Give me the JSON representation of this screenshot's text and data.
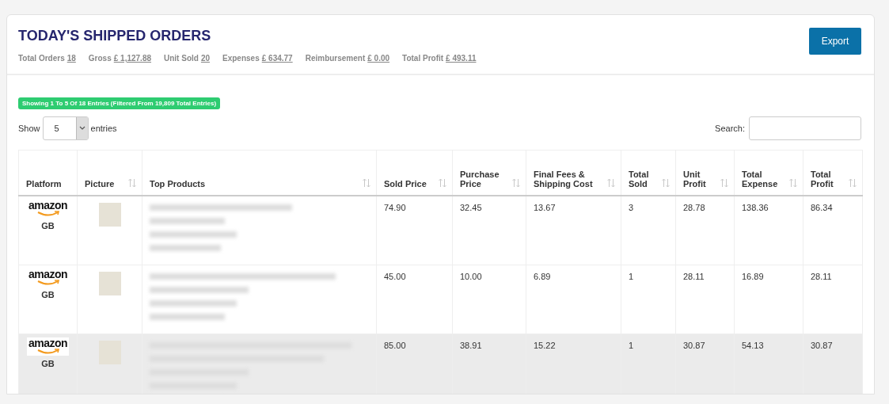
{
  "header": {
    "title": "TODAY'S SHIPPED ORDERS",
    "stats": [
      {
        "label": "Total Orders",
        "value": "18"
      },
      {
        "label": "Gross",
        "value": "£ 1,127.88"
      },
      {
        "label": "Unit Sold",
        "value": "20"
      },
      {
        "label": "Expenses",
        "value": "£ 634.77"
      },
      {
        "label": "Reimbursement",
        "value": "£ 0.00"
      },
      {
        "label": "Total Profit",
        "value": "£ 493.11"
      }
    ],
    "export_button": "Export"
  },
  "info_badge": "Showing 1 To 5 Of 18 Entries (Filtered From 19,809 Total Entries)",
  "length_control": {
    "before": "Show",
    "value": "5",
    "after": "entries"
  },
  "search": {
    "label": "Search:"
  },
  "table": {
    "columns": [
      {
        "label": "Platform",
        "sortable": false
      },
      {
        "label": "Picture",
        "sortable": true
      },
      {
        "label": "Top Products",
        "sortable": true
      },
      {
        "label": "Sold Price",
        "sortable": true
      },
      {
        "label": "Purchase Price",
        "sortable": true
      },
      {
        "label": "Final Fees & Shipping Cost",
        "sortable": true
      },
      {
        "label": "Total Sold",
        "sortable": true
      },
      {
        "label": "Unit Profit",
        "sortable": true
      },
      {
        "label": "Total Expense",
        "sortable": true
      },
      {
        "label": "Total Profit",
        "sortable": true
      }
    ],
    "rows": [
      {
        "platform": {
          "logo": "amazon",
          "region": "GB"
        },
        "selected": false,
        "sold_price": "74.90",
        "purchase_price": "32.45",
        "final_fees_shipping_cost": "13.67",
        "total_sold": "3",
        "unit_profit": "28.78",
        "total_expense": "138.36",
        "total_profit": "86.34"
      },
      {
        "platform": {
          "logo": "amazon",
          "region": "GB"
        },
        "selected": false,
        "sold_price": "45.00",
        "purchase_price": "10.00",
        "final_fees_shipping_cost": "6.89",
        "total_sold": "1",
        "unit_profit": "28.11",
        "total_expense": "16.89",
        "total_profit": "28.11"
      },
      {
        "platform": {
          "logo": "amazon",
          "region": "GB"
        },
        "selected": true,
        "sold_price": "85.00",
        "purchase_price": "38.91",
        "final_fees_shipping_cost": "15.22",
        "total_sold": "1",
        "unit_profit": "30.87",
        "total_expense": "54.13",
        "total_profit": "30.87"
      }
    ]
  }
}
